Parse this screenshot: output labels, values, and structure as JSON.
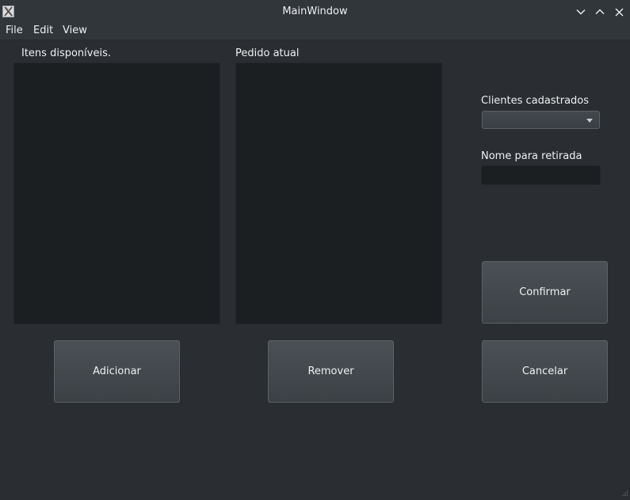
{
  "window": {
    "title": "MainWindow",
    "icon": "x-app-icon",
    "controls": [
      "minimize-icon",
      "maximize-icon",
      "close-icon"
    ]
  },
  "menubar": {
    "items": [
      {
        "label": "File"
      },
      {
        "label": "Edit"
      },
      {
        "label": "View"
      }
    ]
  },
  "available_items": {
    "label": "Itens disponíveis.",
    "items": []
  },
  "current_order": {
    "label": "Pedido atual",
    "items": []
  },
  "clients": {
    "label": "Clientes cadastrados",
    "selected": ""
  },
  "pickup_name": {
    "label": "Nome para retirada",
    "value": ""
  },
  "buttons": {
    "add": "Adicionar",
    "remove": "Remover",
    "confirm": "Confirmar",
    "cancel": "Cancelar"
  }
}
